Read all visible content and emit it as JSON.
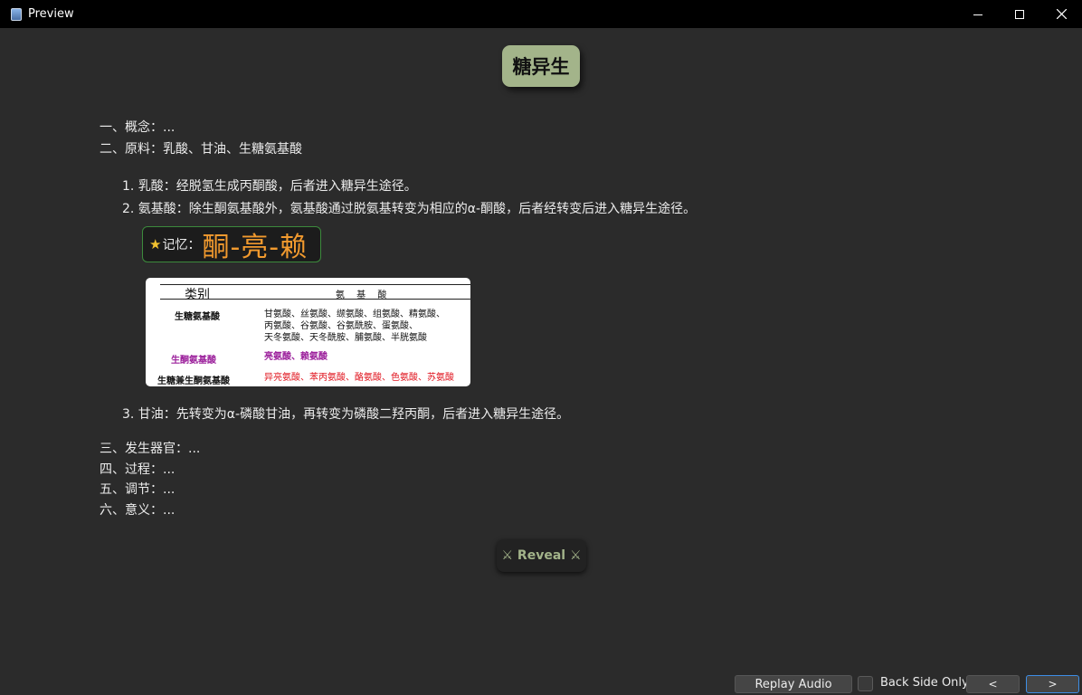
{
  "window": {
    "title": "Preview",
    "icon": "anki-app-icon"
  },
  "card": {
    "title": "糖异生",
    "sections_top": [
      "一、概念：...",
      "二、原料：乳酸、甘油、生糖氨基酸"
    ],
    "items": [
      "1. 乳酸：经脱氢生成丙酮酸，后者进入糖异生途径。",
      "2. 氨基酸：除生酮氨基酸外，氨基酸通过脱氨基转变为相应的α-酮酸，后者经转变后进入糖异生途径。",
      "3. 甘油：先转变为α-磷酸甘油，再转变为磷酸二羟丙酮，后者进入糖异生途径。"
    ],
    "memory": {
      "star": "★",
      "label": "记忆：",
      "value": "酮-亮-赖"
    },
    "table": {
      "header_category": "类别",
      "header_aa": "氨 基 酸",
      "rows": [
        {
          "category": "生糖氨基酸",
          "lines": [
            "甘氨酸、丝氨酸、缬氨酸、组氨酸、精氨酸、",
            "丙氨酸、谷氨酸、谷氨酰胺、蛋氨酸、",
            "天冬氨酸、天冬酰胺、脯氨酸、半胱氨酸"
          ],
          "color": "#111111"
        },
        {
          "category": "生酮氨基酸",
          "lines": [
            "亮氨酸、赖氨酸"
          ],
          "color": "#9b1f9b"
        },
        {
          "category": "生糖兼生酮氨基酸",
          "lines": [
            "异亮氨酸、苯丙氨酸、酪氨酸、色氨酸、苏氨酸"
          ],
          "color": "#e0141e"
        }
      ]
    },
    "sections_bottom": [
      "三、发生器官：...",
      "四、过程：...",
      "五、调节：...",
      "六、意义：..."
    ],
    "reveal_label": "⚔ Reveal ⚔"
  },
  "bottom_bar": {
    "replay_label": "Replay Audio",
    "back_side_only_label": "Back Side Only",
    "back_side_only_checked": false,
    "prev_label": "<",
    "next_label": ">"
  },
  "colors": {
    "background": "#2b2b2b",
    "title_bg": "#a3b48a",
    "memory_value": "#f29a2e",
    "memory_border": "#3c8a3c",
    "accent_focus": "#3d8ee6"
  }
}
